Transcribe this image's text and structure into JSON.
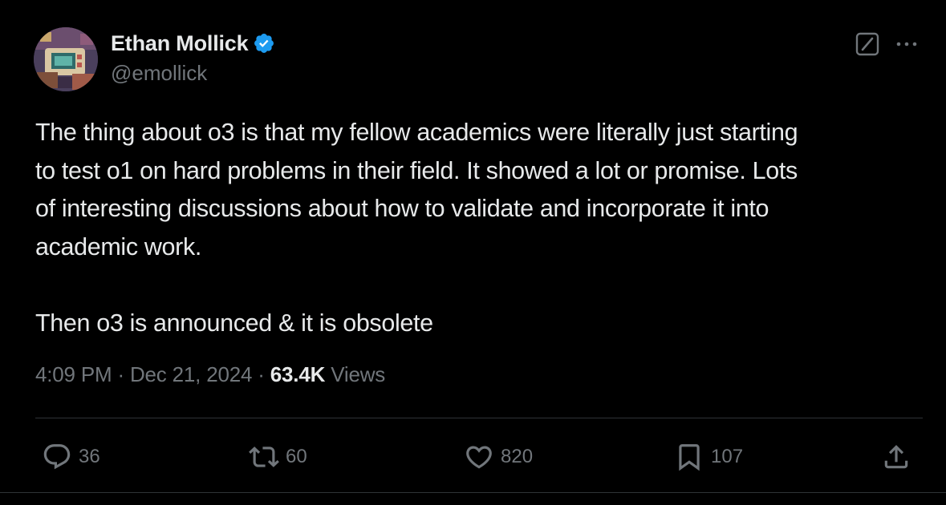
{
  "author": {
    "display_name": "Ethan Mollick",
    "handle": "@emollick",
    "verified": true,
    "verified_color": "#1d9bf0"
  },
  "header_icons": [
    "grok-icon",
    "more-options-icon"
  ],
  "tweet": {
    "lines": [
      "The thing about o3 is that my fellow academics were literally just starting",
      "to test o1 on hard problems in their field. It showed a lot or promise. Lots",
      "of interesting discussions about how to validate and incorporate it into",
      "academic work.",
      "Then o3 is announced & it is obsolete"
    ]
  },
  "meta": {
    "time": "4:09 PM",
    "separator": "·",
    "date": "Dec 21, 2024",
    "views_count": "63.4K",
    "views_label": "Views"
  },
  "actions": {
    "replies": "36",
    "reposts": "60",
    "likes": "820",
    "bookmarks": "107"
  },
  "colors": {
    "background": "#000000",
    "text_primary": "#e7e9ea",
    "text_secondary": "#71767b",
    "divider": "#2f3336"
  }
}
